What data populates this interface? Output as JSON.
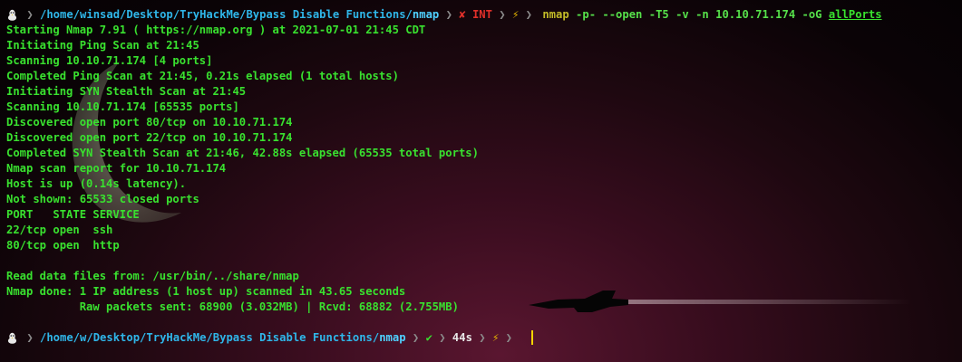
{
  "top_prompt": {
    "os_icon": "linux-tux-icon",
    "path_prefix": "/home/winsad/Desktop/TryHackMe/Bypass Disable Functions/",
    "path_last": "nmap",
    "status_icon": "✘",
    "status_text": "INT",
    "root_icon": "⚡",
    "command_name": "nmap",
    "command_args": "-p- --open -T5 -v -n 10.10.71.174 -oG",
    "command_last_arg": "allPorts"
  },
  "output_lines": [
    "Starting Nmap 7.91 ( https://nmap.org ) at 2021-07-01 21:45 CDT",
    "Initiating Ping Scan at 21:45",
    "Scanning 10.10.71.174 [4 ports]",
    "Completed Ping Scan at 21:45, 0.21s elapsed (1 total hosts)",
    "Initiating SYN Stealth Scan at 21:45",
    "Scanning 10.10.71.174 [65535 ports]",
    "Discovered open port 80/tcp on 10.10.71.174",
    "Discovered open port 22/tcp on 10.10.71.174",
    "Completed SYN Stealth Scan at 21:46, 42.88s elapsed (65535 total ports)",
    "Nmap scan report for 10.10.71.174",
    "Host is up (0.14s latency).",
    "Not shown: 65533 closed ports",
    "PORT   STATE SERVICE",
    "22/tcp open  ssh",
    "80/tcp open  http",
    "",
    "Read data files from: /usr/bin/../share/nmap",
    "Nmap done: 1 IP address (1 host up) scanned in 43.65 seconds",
    "           Raw packets sent: 68900 (3.032MB) | Rcvd: 68882 (2.755MB)"
  ],
  "bottom_prompt": {
    "os_icon": "linux-tux-icon",
    "path_prefix": "/home/w/Desktop/TryHackMe/Bypass Disable Functions/",
    "path_last": "nmap",
    "status_icon": "✔",
    "duration": "44s",
    "root_icon": "⚡"
  },
  "colors": {
    "output_text": "#39e12f",
    "path": "#2fb6e9",
    "error": "#e0302a",
    "root": "#e8b800"
  }
}
